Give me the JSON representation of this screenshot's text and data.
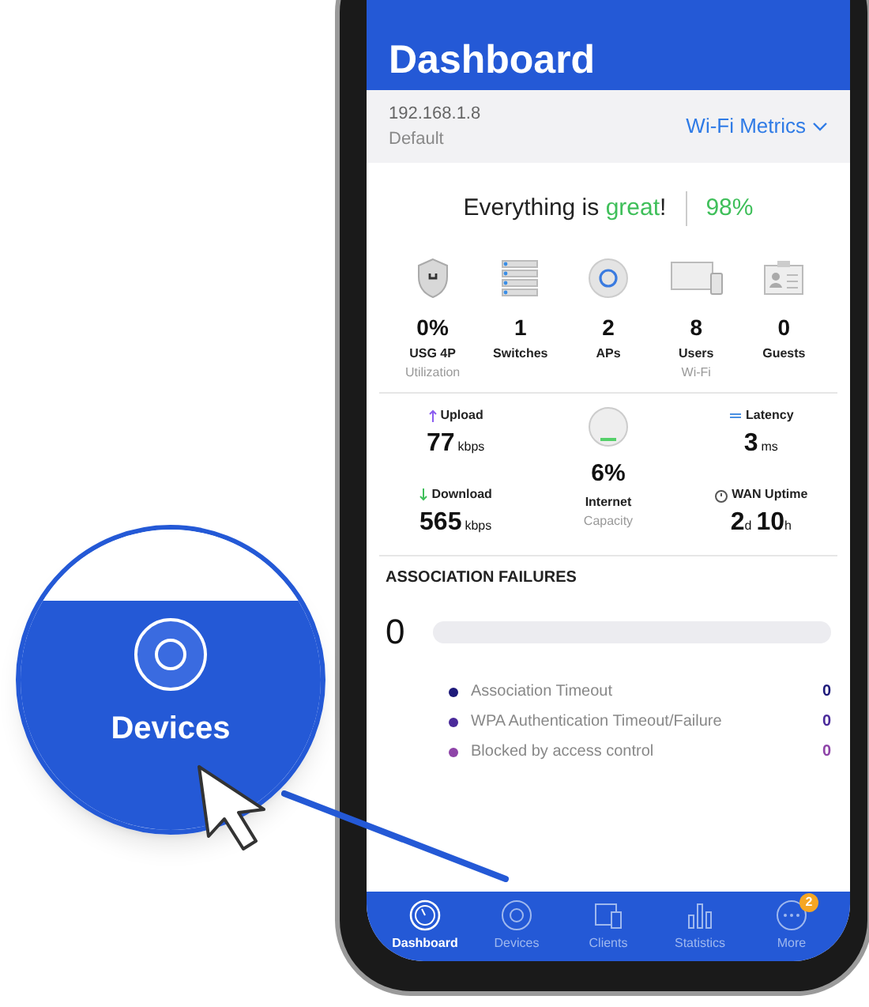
{
  "header": {
    "title": "Dashboard"
  },
  "controller": {
    "address": "192.168.1.8",
    "site": "Default",
    "metrics_menu": "Wi-Fi Metrics"
  },
  "health": {
    "prefix": "Everything is ",
    "highlight": "great",
    "suffix": "!",
    "score": "98%"
  },
  "devices": [
    {
      "kind": "shield",
      "value": "0%",
      "label": "USG 4P",
      "sublabel": "Utilization"
    },
    {
      "kind": "switch",
      "value": "1",
      "label": "Switches"
    },
    {
      "kind": "ap",
      "value": "2",
      "label": "APs"
    },
    {
      "kind": "screens",
      "value": "8",
      "label": "Users",
      "sublabel": "Wi-Fi"
    },
    {
      "kind": "badge",
      "value": "0",
      "label": "Guests"
    }
  ],
  "traffic": {
    "upload": {
      "label": "Upload",
      "value": "77",
      "unit": "kbps"
    },
    "download": {
      "label": "Download",
      "value": "565",
      "unit": "kbps"
    },
    "internet": {
      "value": "6%",
      "label": "Internet",
      "sublabel": "Capacity"
    },
    "latency": {
      "label": "Latency",
      "value": "3",
      "unit": "ms"
    },
    "wan_uptime": {
      "label": "WAN Uptime",
      "days": "2",
      "days_unit": "d",
      "hours": "10",
      "hours_unit": "h"
    }
  },
  "association_failures": {
    "title": "ASSOCIATION FAILURES",
    "total": "0",
    "level": 0,
    "items": [
      {
        "label": "Association Timeout",
        "count": "0",
        "color": "#1e1a7a"
      },
      {
        "label": "WPA Authentication Timeout/Failure",
        "count": "0",
        "color": "#4a2a9a"
      },
      {
        "label": "Blocked by access control",
        "count": "0",
        "color": "#8e44a8"
      }
    ]
  },
  "nav": [
    {
      "kind": "dashboard",
      "label": "Dashboard",
      "selected": true
    },
    {
      "kind": "devices",
      "label": "Devices",
      "selected": false
    },
    {
      "kind": "clients",
      "label": "Clients",
      "selected": false
    },
    {
      "kind": "statistics",
      "label": "Statistics",
      "selected": false
    },
    {
      "kind": "more",
      "label": "More",
      "selected": false,
      "badge": "2"
    }
  ],
  "callout": {
    "label": "Devices"
  }
}
